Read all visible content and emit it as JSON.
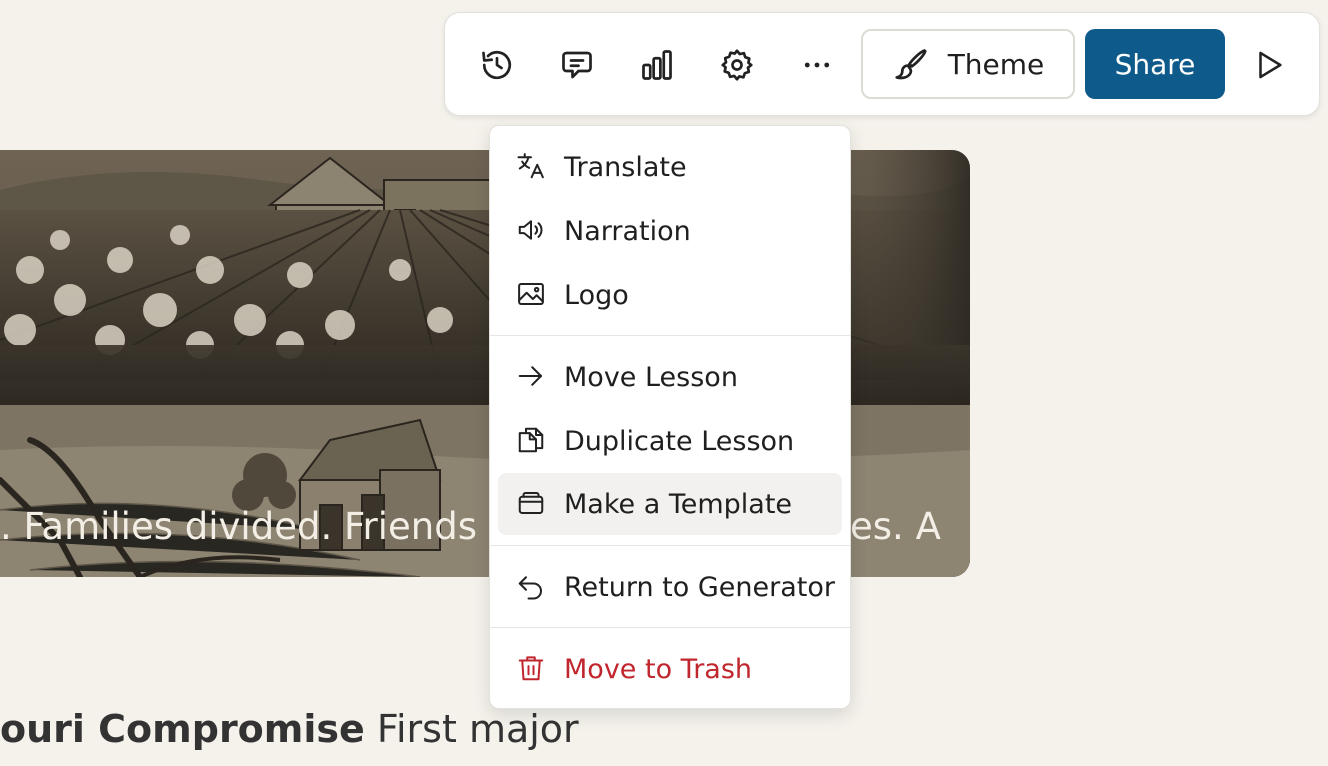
{
  "toolbar": {
    "icons": [
      {
        "name": "history-icon",
        "label": ""
      },
      {
        "name": "comment-icon",
        "label": ""
      },
      {
        "name": "analytics-icon",
        "label": ""
      },
      {
        "name": "settings-icon",
        "label": ""
      },
      {
        "name": "more-icon",
        "label": ""
      }
    ],
    "theme_label": "Theme",
    "share_label": "Share",
    "share_color": "#0e5a8a"
  },
  "menu": {
    "items": [
      {
        "label": "Translate",
        "icon": "translate-icon"
      },
      {
        "label": "Narration",
        "icon": "speaker-icon"
      },
      {
        "label": "Logo",
        "icon": "image-icon"
      },
      {
        "label": "Move Lesson",
        "icon": "arrow-right-icon"
      },
      {
        "label": "Duplicate Lesson",
        "icon": "duplicate-icon"
      },
      {
        "label": "Make a Template",
        "icon": "template-icon",
        "highlighted": true
      },
      {
        "label": "Return to Generator",
        "icon": "return-icon"
      },
      {
        "label": "Move to Trash",
        "icon": "trash-icon",
        "danger": true
      }
    ],
    "danger_color": "#c0262d"
  },
  "hero": {
    "caption_left": ". Families divided. Friends",
    "caption_right": "es. A"
  },
  "content": {
    "heading_bold": "ouri Compromise",
    "heading_rest": " First major"
  }
}
